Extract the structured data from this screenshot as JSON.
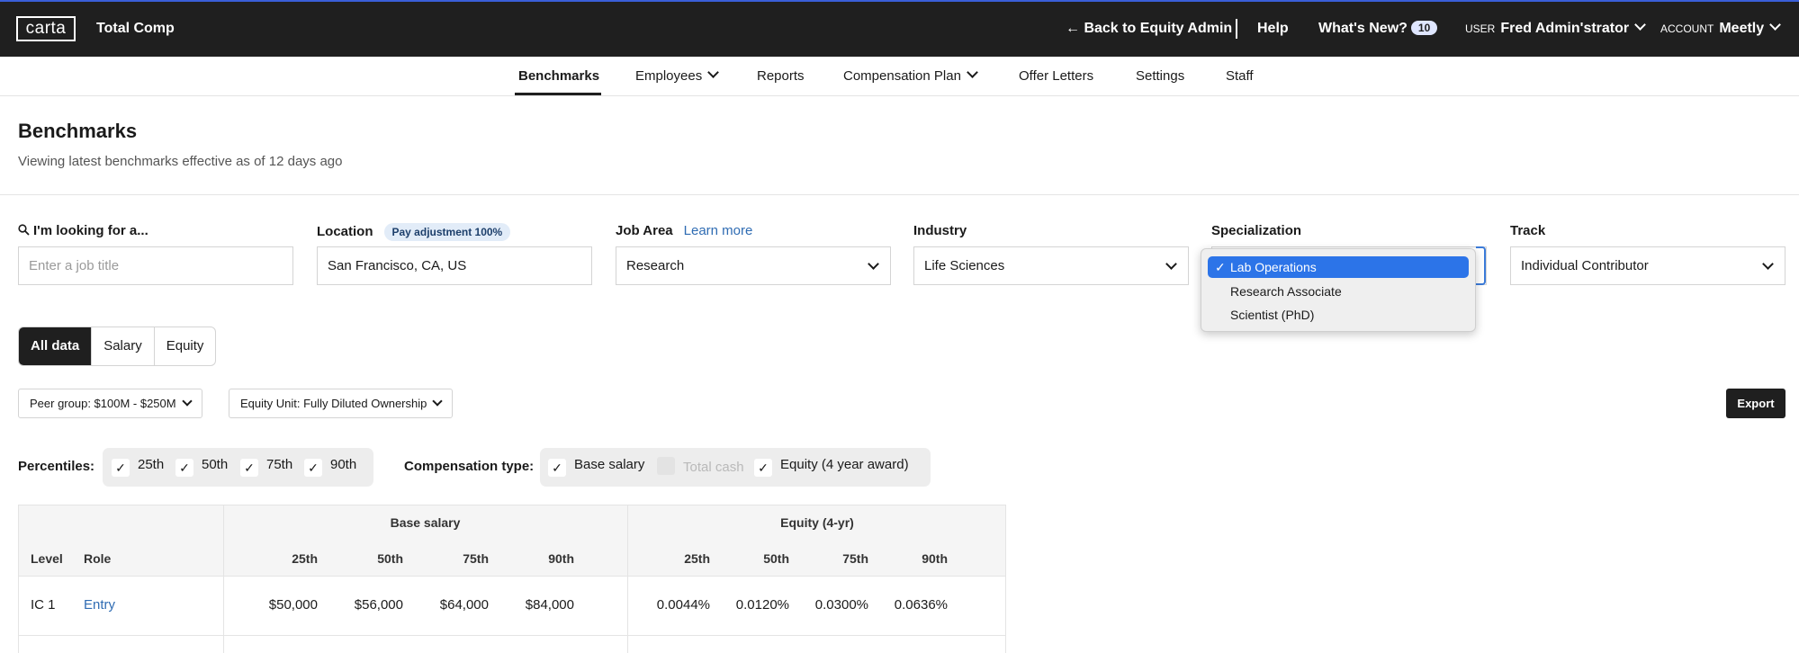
{
  "topbar": {
    "logo": "carta",
    "product": "Total Comp",
    "back_link": "← Back to Equity Admin",
    "help": "Help",
    "whats_new": "What's New?",
    "whats_new_count": "10",
    "user_caption": "USER",
    "user_name": "Fred Admin'strator",
    "account_caption": "ACCOUNT",
    "account_name": "Meetly"
  },
  "subnav": {
    "items": [
      "Benchmarks",
      "Employees",
      "Reports",
      "Compensation Plan",
      "Offer Letters",
      "Settings",
      "Staff"
    ],
    "active": "Benchmarks"
  },
  "page": {
    "title": "Benchmarks",
    "subtitle": "Viewing latest benchmarks effective as of 12 days ago"
  },
  "filters": {
    "search": {
      "label": "I'm looking for a...",
      "placeholder": "Enter a job title"
    },
    "location": {
      "label": "Location",
      "pill": "Pay adjustment 100%",
      "value": "San Francisco, CA, US"
    },
    "job_area": {
      "label": "Job Area",
      "link": "Learn more",
      "value": "Research"
    },
    "industry": {
      "label": "Industry",
      "value": "Life Sciences"
    },
    "specialization": {
      "label": "Specialization",
      "options": [
        "Lab Operations",
        "Research Associate",
        "Scientist (PhD)"
      ],
      "selected": "Lab Operations"
    },
    "track": {
      "label": "Track",
      "value": "Individual Contributor"
    }
  },
  "view_tabs": {
    "items": [
      "All data",
      "Salary",
      "Equity"
    ],
    "active": "All data"
  },
  "controls": {
    "peer_group": "Peer group: $100M - $250M",
    "equity_unit": "Equity Unit: Fully Diluted Ownership",
    "export": "Export"
  },
  "percentiles": {
    "label": "Percentiles:",
    "items": [
      {
        "label": "25th",
        "checked": true
      },
      {
        "label": "50th",
        "checked": true
      },
      {
        "label": "75th",
        "checked": true
      },
      {
        "label": "90th",
        "checked": true
      }
    ]
  },
  "comp_type": {
    "label": "Compensation type:",
    "items": [
      {
        "label": "Base salary",
        "checked": true,
        "disabled": false
      },
      {
        "label": "Total cash",
        "checked": false,
        "disabled": true
      },
      {
        "label": "Equity (4 year award)",
        "checked": true,
        "disabled": false
      }
    ]
  },
  "table": {
    "group_headers": [
      "Base salary",
      "Equity (4-yr)"
    ],
    "col_level": "Level",
    "col_role": "Role",
    "percentile_headers": [
      "25th",
      "50th",
      "75th",
      "90th"
    ],
    "rows": [
      {
        "level": "IC 1",
        "role": "Entry",
        "base": [
          "$50,000",
          "$56,000",
          "$64,000",
          "$84,000"
        ],
        "equity": [
          "0.0044%",
          "0.0120%",
          "0.0300%",
          "0.0636%"
        ]
      }
    ]
  },
  "colors": {
    "topbar": "#1f1f1f",
    "accent_blue": "#2c74e8",
    "link": "#2f6cb3"
  }
}
